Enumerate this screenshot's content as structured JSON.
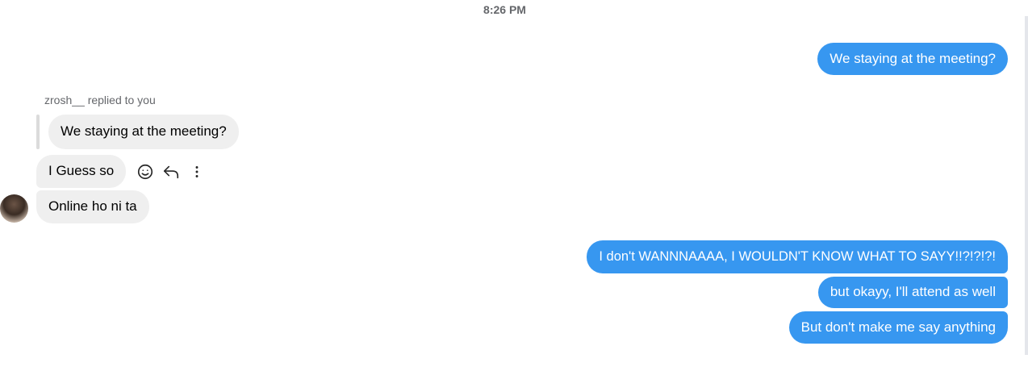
{
  "conversation": {
    "timestamp": "8:26 PM",
    "messages": {
      "out_1": "We staying at the meeting?",
      "reply_label": "zrosh__ replied to you",
      "quoted": "We staying at the meeting?",
      "in_1": "I Guess so",
      "in_2": "Online ho ni ta",
      "out_2": "I don't WANNNAAAA, I WOULDN'T KNOW WHAT TO SAYY!!?!?!?!",
      "out_3": "but okayy, I'll attend as well",
      "out_4": "But don't make me say anything"
    }
  },
  "icons": {
    "react": "smiley-icon",
    "reply": "reply-arrow-icon",
    "more": "more-vertical-icon",
    "avatar": "user-avatar"
  },
  "colors": {
    "outgoing_bubble": "#3797f0",
    "incoming_bubble": "#efefef",
    "timestamp": "#65676b"
  }
}
